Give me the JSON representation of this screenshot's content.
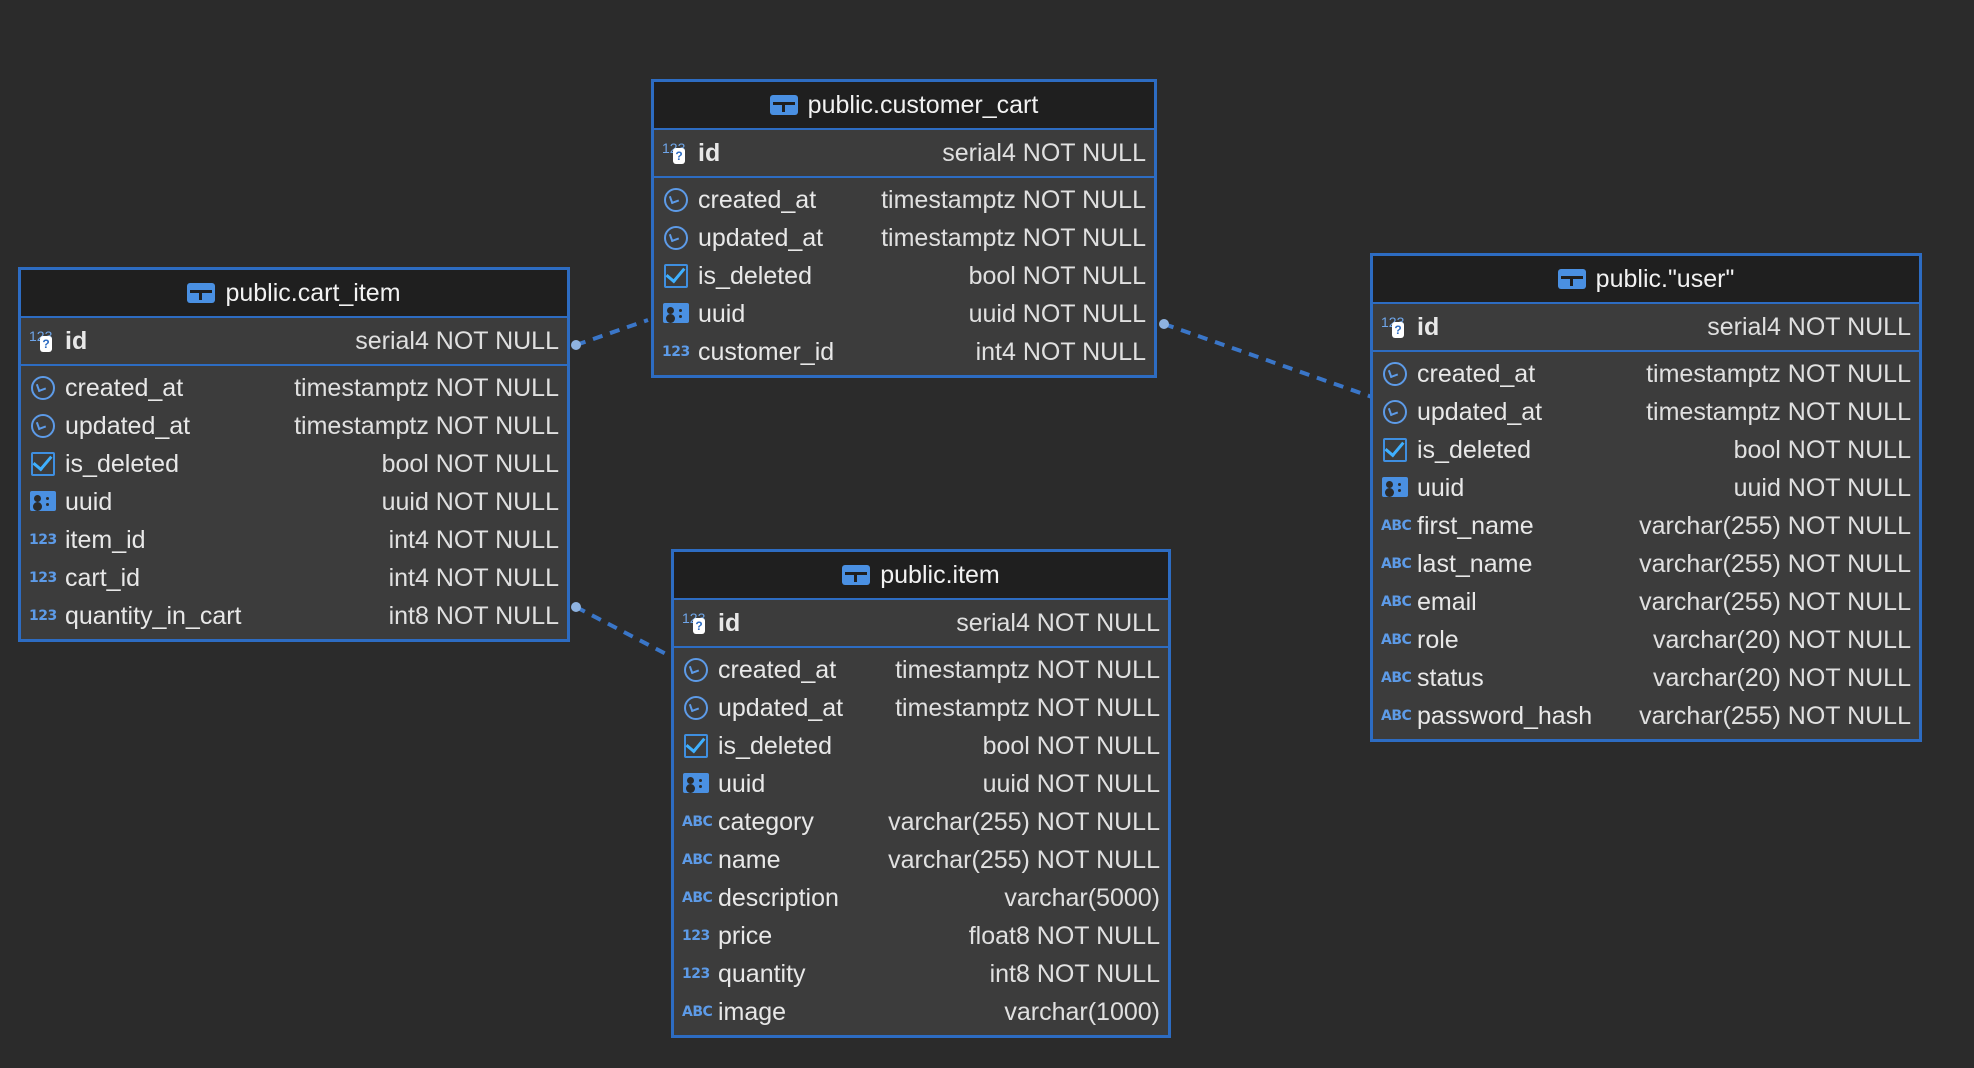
{
  "colors": {
    "background": "#2b2b2b",
    "border": "#2d6cc2",
    "header": "#1f1f1f",
    "body": "#3c3c3c",
    "connector": "#3a76c8"
  },
  "tables": {
    "customer_cart": {
      "title": "public.customer_cart",
      "pk": {
        "name": "id",
        "type": "serial4 NOT NULL",
        "icon": "key-number-icon"
      },
      "columns": [
        {
          "name": "created_at",
          "type": "timestamptz NOT NULL",
          "icon": "clock-icon"
        },
        {
          "name": "updated_at",
          "type": "timestamptz NOT NULL",
          "icon": "clock-icon"
        },
        {
          "name": "is_deleted",
          "type": "bool NOT NULL",
          "icon": "checkbox-icon"
        },
        {
          "name": "uuid",
          "type": "uuid NOT NULL",
          "icon": "id-card-icon"
        },
        {
          "name": "customer_id",
          "type": "int4 NOT NULL",
          "icon": "number-icon"
        }
      ]
    },
    "cart_item": {
      "title": "public.cart_item",
      "pk": {
        "name": "id",
        "type": "serial4 NOT NULL",
        "icon": "key-number-icon"
      },
      "columns": [
        {
          "name": "created_at",
          "type": "timestamptz NOT NULL",
          "icon": "clock-icon"
        },
        {
          "name": "updated_at",
          "type": "timestamptz NOT NULL",
          "icon": "clock-icon"
        },
        {
          "name": "is_deleted",
          "type": "bool NOT NULL",
          "icon": "checkbox-icon"
        },
        {
          "name": "uuid",
          "type": "uuid NOT NULL",
          "icon": "id-card-icon"
        },
        {
          "name": "item_id",
          "type": "int4 NOT NULL",
          "icon": "number-icon"
        },
        {
          "name": "cart_id",
          "type": "int4 NOT NULL",
          "icon": "number-icon"
        },
        {
          "name": "quantity_in_cart",
          "type": "int8 NOT NULL",
          "icon": "number-icon"
        }
      ]
    },
    "user": {
      "title": "public.\"user\"",
      "pk": {
        "name": "id",
        "type": "serial4 NOT NULL",
        "icon": "key-number-icon"
      },
      "columns": [
        {
          "name": "created_at",
          "type": "timestamptz NOT NULL",
          "icon": "clock-icon"
        },
        {
          "name": "updated_at",
          "type": "timestamptz NOT NULL",
          "icon": "clock-icon"
        },
        {
          "name": "is_deleted",
          "type": "bool NOT NULL",
          "icon": "checkbox-icon"
        },
        {
          "name": "uuid",
          "type": "uuid NOT NULL",
          "icon": "id-card-icon"
        },
        {
          "name": "first_name",
          "type": "varchar(255) NOT NULL",
          "icon": "text-icon"
        },
        {
          "name": "last_name",
          "type": "varchar(255) NOT NULL",
          "icon": "text-icon"
        },
        {
          "name": "email",
          "type": "varchar(255) NOT NULL",
          "icon": "text-icon"
        },
        {
          "name": "role",
          "type": "varchar(20) NOT NULL",
          "icon": "text-icon"
        },
        {
          "name": "status",
          "type": "varchar(20) NOT NULL",
          "icon": "text-icon"
        },
        {
          "name": "password_hash",
          "type": "varchar(255) NOT NULL",
          "icon": "text-icon"
        }
      ]
    },
    "item": {
      "title": "public.item",
      "pk": {
        "name": "id",
        "type": "serial4 NOT NULL",
        "icon": "key-number-icon"
      },
      "columns": [
        {
          "name": "created_at",
          "type": "timestamptz NOT NULL",
          "icon": "clock-icon"
        },
        {
          "name": "updated_at",
          "type": "timestamptz NOT NULL",
          "icon": "clock-icon"
        },
        {
          "name": "is_deleted",
          "type": "bool NOT NULL",
          "icon": "checkbox-icon"
        },
        {
          "name": "uuid",
          "type": "uuid NOT NULL",
          "icon": "id-card-icon"
        },
        {
          "name": "category",
          "type": "varchar(255) NOT NULL",
          "icon": "text-icon"
        },
        {
          "name": "name",
          "type": "varchar(255) NOT NULL",
          "icon": "text-icon"
        },
        {
          "name": "description",
          "type": "varchar(5000)",
          "icon": "text-icon"
        },
        {
          "name": "price",
          "type": "float8 NOT NULL",
          "icon": "number-icon"
        },
        {
          "name": "quantity",
          "type": "int8 NOT NULL",
          "icon": "number-icon"
        },
        {
          "name": "image",
          "type": "varchar(1000)",
          "icon": "text-icon"
        }
      ]
    }
  },
  "relations": [
    {
      "from": "cart_item",
      "to": "customer_cart"
    },
    {
      "from": "customer_cart",
      "to": "user"
    },
    {
      "from": "cart_item",
      "to": "item"
    }
  ]
}
